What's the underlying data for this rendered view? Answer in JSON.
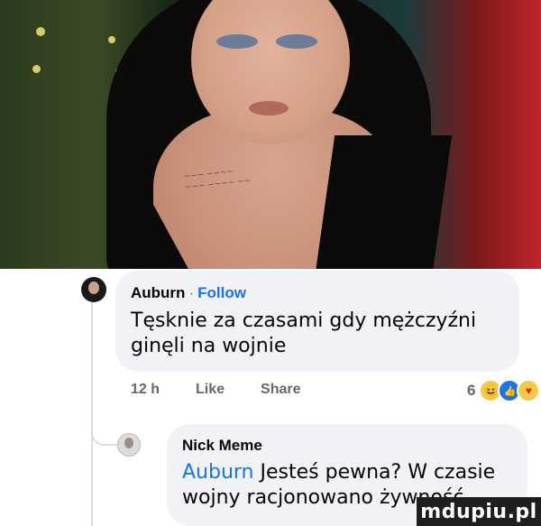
{
  "comment": {
    "author": "Auburn",
    "separator": "·",
    "follow_label": "Follow",
    "text": "Tęsknie za czasami gdy mężczyźni ginęli na wojnie",
    "time": "12 h",
    "like_label": "Like",
    "share_label": "Share",
    "reaction_count": "6",
    "reaction_icons": [
      "haha-icon",
      "like-icon",
      "care-icon"
    ]
  },
  "reply": {
    "author": "Nick Meme",
    "mention": "Auburn",
    "text": " Jesteś pewna? W czasie wojny racjonowano żywność"
  },
  "watermark": "mdupiu.pl",
  "colors": {
    "bubble": "#f0f2f5",
    "link": "#1b74e4",
    "meta": "#65676b",
    "text": "#050505"
  }
}
